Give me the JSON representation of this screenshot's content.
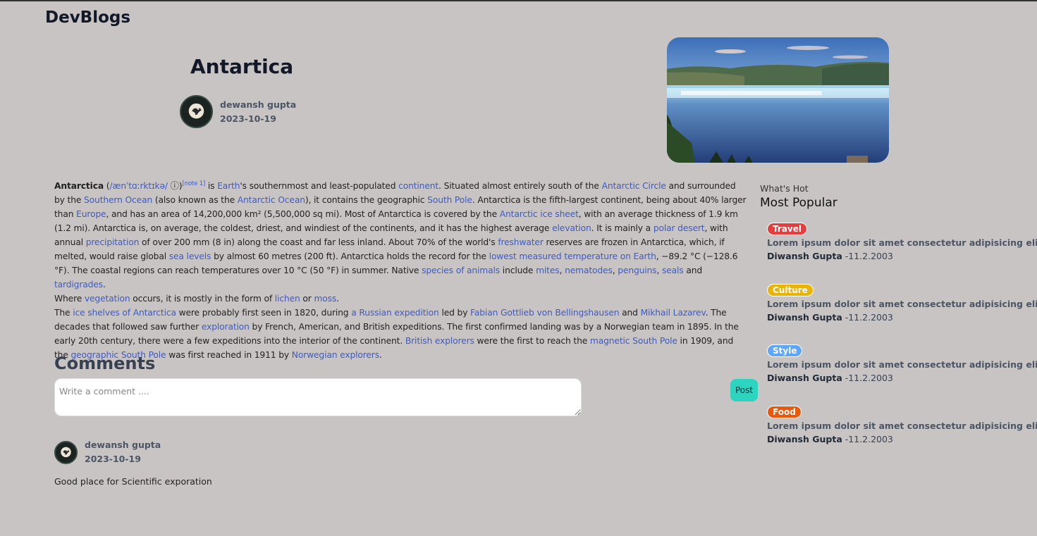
{
  "brand": "DevBlogs",
  "post": {
    "title": "Antartica",
    "author": "dewansh gupta",
    "date": "2023-10-19"
  },
  "article": {
    "p1": [
      {
        "t": "Antarctica",
        "s": "b"
      },
      {
        "t": " ("
      },
      {
        "t": "/ænˈtɑːrktɪkə/",
        "s": "a"
      },
      {
        "t": " ⓘ"
      },
      {
        "t": ")"
      },
      {
        "t": "[note 1]",
        "s": "sup"
      },
      {
        "t": " is "
      },
      {
        "t": "Earth",
        "s": "a"
      },
      {
        "t": "'s southernmost and least-populated "
      },
      {
        "t": "continent",
        "s": "a"
      },
      {
        "t": ". Situated almost entirely south of the "
      },
      {
        "t": "Antarctic Circle",
        "s": "a"
      },
      {
        "t": " and surrounded by the "
      },
      {
        "t": "Southern Ocean",
        "s": "a"
      },
      {
        "t": " (also known as the "
      },
      {
        "t": "Antarctic Ocean",
        "s": "a"
      },
      {
        "t": "), it contains the geographic "
      },
      {
        "t": "South Pole",
        "s": "a"
      },
      {
        "t": ". Antarctica is the fifth-largest continent, being about 40% larger than "
      },
      {
        "t": "Europe",
        "s": "a"
      },
      {
        "t": ", and has an area of 14,200,000 km² (5,500,000 sq mi). Most of Antarctica is covered by the "
      },
      {
        "t": "Antarctic ice sheet",
        "s": "a"
      },
      {
        "t": ", with an average thickness of 1.9 km (1.2 mi). Antarctica is, on average, the coldest, driest, and windiest of the continents, and it has the highest average "
      },
      {
        "t": "elevation",
        "s": "a"
      },
      {
        "t": ". It is mainly a "
      },
      {
        "t": "polar desert",
        "s": "a"
      },
      {
        "t": ", with annual "
      },
      {
        "t": "precipitation",
        "s": "a"
      },
      {
        "t": " of over 200 mm (8 in) along the coast and far less inland. About 70% of the world's "
      },
      {
        "t": "freshwater",
        "s": "a"
      },
      {
        "t": " reserves are frozen in Antarctica, which, if melted, would raise global "
      },
      {
        "t": "sea levels",
        "s": "a"
      },
      {
        "t": " by almost 60 metres (200 ft). Antarctica holds the record for the "
      },
      {
        "t": "lowest measured temperature on Earth",
        "s": "a"
      },
      {
        "t": ", −89.2 °C (−128.6 °F). The coastal regions can reach temperatures over 10 °C (50 °F) in summer. Native "
      },
      {
        "t": "species of animals",
        "s": "a"
      },
      {
        "t": " include "
      },
      {
        "t": "mites",
        "s": "a"
      },
      {
        "t": ", "
      },
      {
        "t": "nematodes",
        "s": "a"
      },
      {
        "t": ", "
      },
      {
        "t": "penguins",
        "s": "a"
      },
      {
        "t": ", "
      },
      {
        "t": "seals",
        "s": "a"
      },
      {
        "t": " and "
      },
      {
        "t": "tardigrades",
        "s": "a"
      },
      {
        "t": "."
      }
    ],
    "p2": [
      {
        "t": "Where "
      },
      {
        "t": "vegetation",
        "s": "a"
      },
      {
        "t": " occurs, it is mostly in the form of "
      },
      {
        "t": "lichen",
        "s": "a"
      },
      {
        "t": " or "
      },
      {
        "t": "moss",
        "s": "a"
      },
      {
        "t": "."
      }
    ],
    "p3": [
      {
        "t": "The "
      },
      {
        "t": "ice shelves of Antarctica",
        "s": "a"
      },
      {
        "t": " were probably first seen in 1820, during "
      },
      {
        "t": "a Russian expedition",
        "s": "a"
      },
      {
        "t": " led by "
      },
      {
        "t": "Fabian Gottlieb von Bellingshausen",
        "s": "a"
      },
      {
        "t": " and "
      },
      {
        "t": "Mikhail Lazarev",
        "s": "a"
      },
      {
        "t": ". The decades that followed saw further "
      },
      {
        "t": "exploration",
        "s": "a"
      },
      {
        "t": " by French, American, and British expeditions. The first confirmed landing was by a Norwegian team in 1895. In the early 20th century, there were a few expeditions into the interior of the continent. "
      },
      {
        "t": "British explorers",
        "s": "a"
      },
      {
        "t": " were the first to reach the "
      },
      {
        "t": "magnetic South Pole",
        "s": "a"
      },
      {
        "t": " in 1909, and the "
      },
      {
        "t": "geographic South Pole",
        "s": "a"
      },
      {
        "t": " was first reached in 1911 by "
      },
      {
        "t": "Norwegian explorers",
        "s": "a"
      },
      {
        "t": "."
      }
    ]
  },
  "comments": {
    "heading": "Comments",
    "placeholder": "Write a comment ....",
    "post_label": "Post",
    "items": [
      {
        "author": "dewansh gupta",
        "date": "2023-10-19",
        "text": "Good place for Scientific exporation"
      }
    ]
  },
  "sidebar": {
    "kicker": "What's Hot",
    "title": "Most Popular",
    "items": [
      {
        "tag": "Travel",
        "tag_color": "#e53e3e",
        "desc": "Lorem ipsum dolor sit amet consectetur adipisicing elit.",
        "author": "Diwansh Gupta",
        "date": "-11.2.2003"
      },
      {
        "tag": "Culture",
        "tag_color": "#eab308",
        "desc": "Lorem ipsum dolor sit amet consectetur adipisicing elit.",
        "author": "Diwansh Gupta",
        "date": "-11.2.2003"
      },
      {
        "tag": "Style",
        "tag_color": "#60a5fa",
        "desc": "Lorem ipsum dolor sit amet consectetur adipisicing elit.",
        "author": "Diwansh Gupta",
        "date": "-11.2.2003"
      },
      {
        "tag": "Food",
        "tag_color": "#ea580c",
        "desc": "Lorem ipsum dolor sit amet consectetur adipisicing elit.",
        "author": "Diwansh Gupta",
        "date": "-11.2.2003"
      }
    ]
  }
}
